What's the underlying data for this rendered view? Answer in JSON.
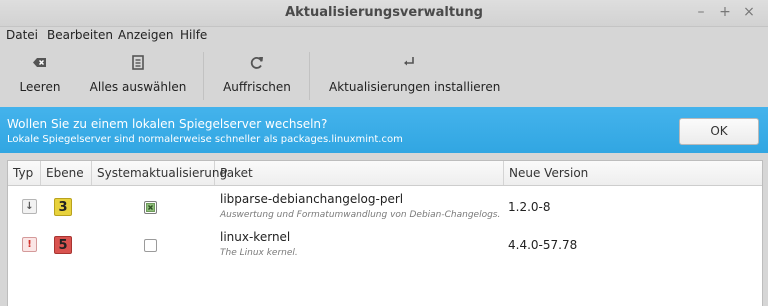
{
  "window": {
    "title": "Aktualisierungsverwaltung"
  },
  "menu": [
    "Datei",
    "Bearbeiten",
    "Anzeigen",
    "Hilfe"
  ],
  "toolbar": [
    {
      "label": "Leeren",
      "icon": "clear-icon"
    },
    {
      "label": "Alles auswählen",
      "icon": "select-all-icon"
    },
    {
      "label": "Auffrischen",
      "icon": "refresh-icon"
    },
    {
      "label": "Aktualisierungen installieren",
      "icon": "install-icon"
    }
  ],
  "infobar": {
    "line1": "Wollen Sie zu einem lokalen Spiegelserver wechseln?",
    "line2": "Lokale Spiegelserver sind normalerweise schneller als packages.linuxmint.com",
    "ok_label": "OK",
    "color": "#3daee9"
  },
  "table": {
    "columns": [
      "Typ",
      "Ebene",
      "Systemaktualisierung",
      "Paket",
      "Neue Version"
    ],
    "rows": [
      {
        "type": "package",
        "level": "3",
        "level_color": "#e8d23c",
        "system": true,
        "name": "libparse-debianchangelog-perl",
        "desc": "Auswertung und Formatumwandlung von Debian-Changelogs.",
        "version": "1.2.0-8"
      },
      {
        "type": "security",
        "level": "5",
        "level_color": "#d9534f",
        "system": false,
        "name": "linux-kernel",
        "desc": "The Linux kernel.",
        "version": "4.4.0-57.78"
      }
    ]
  }
}
